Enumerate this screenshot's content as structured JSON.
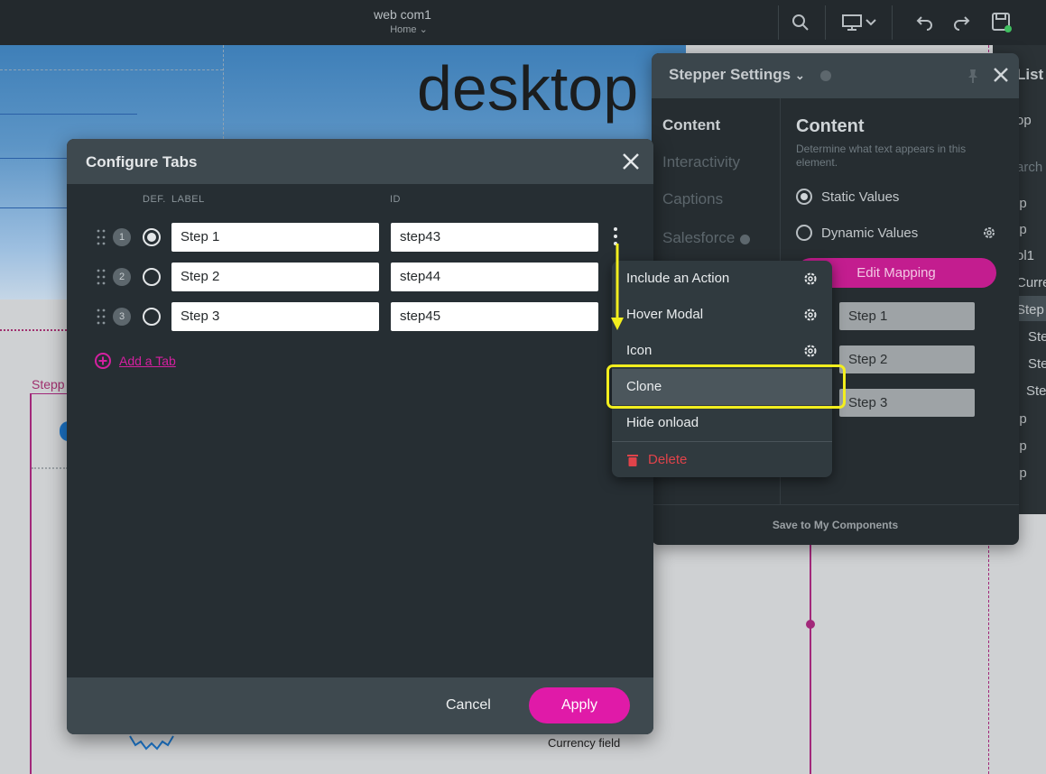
{
  "topbar": {
    "site_name": "web com1",
    "page_name": "Home"
  },
  "canvas": {
    "hero_text": "desktop",
    "stepper_label": "Stepp",
    "currency_label": "Currency field"
  },
  "settings": {
    "title": "Stepper Settings",
    "nav": [
      "Content",
      "Interactivity",
      "Captions",
      "Salesforce"
    ],
    "content_title": "Content",
    "content_desc": "Determine what text appears in this element.",
    "static_values": "Static Values",
    "dynamic_values": "Dynamic Values",
    "edit_mapping": "Edit Mapping",
    "steps": [
      "Step 1",
      "Step 2",
      "Step 3"
    ],
    "footer": "Save to My Components"
  },
  "right_strip": [
    "List",
    "op",
    "arch",
    "ip",
    "ip",
    "ol1",
    "Curre",
    "Step",
    "Ste",
    "Ste",
    "Ste",
    "ip",
    "ip",
    "ip"
  ],
  "modal": {
    "title": "Configure Tabs",
    "col_def": "DEF.",
    "col_label": "LABEL",
    "col_id": "ID",
    "rows": [
      {
        "num": "1",
        "label": "Step 1",
        "id": "step43",
        "default": true
      },
      {
        "num": "2",
        "label": "Step 2",
        "id": "step44",
        "default": false
      },
      {
        "num": "3",
        "label": "Step 3",
        "id": "step45",
        "default": false
      }
    ],
    "add_tab": "Add a Tab",
    "cancel": "Cancel",
    "apply": "Apply"
  },
  "menu": {
    "items": [
      "Include an Action",
      "Hover Modal",
      "Icon",
      "Clone",
      "Hide onload"
    ],
    "delete": "Delete"
  },
  "colors": {
    "accent": "#e01aa8",
    "highlight": "#f2ee1e",
    "danger": "#e0434a"
  }
}
